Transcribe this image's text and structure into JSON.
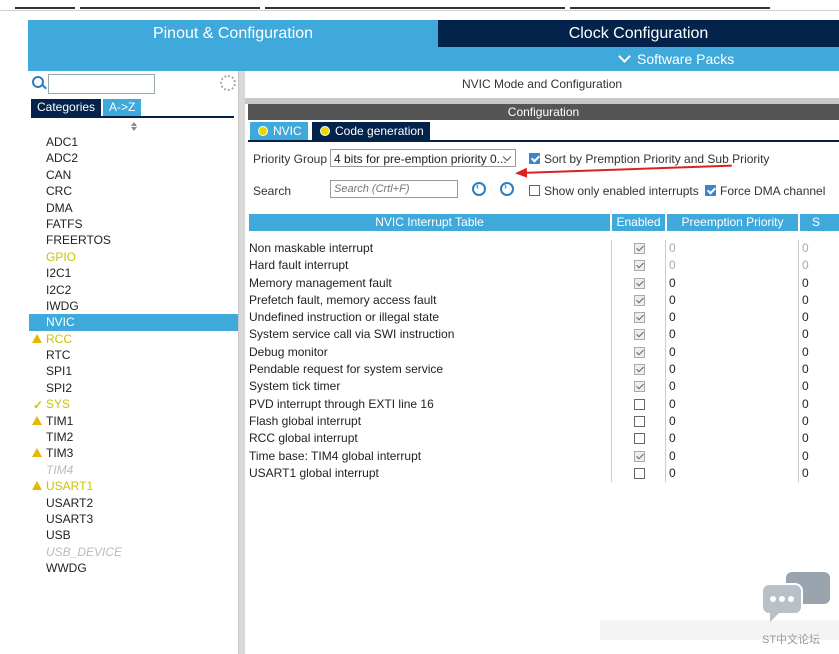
{
  "tabs": {
    "pinout": "Pinout & Configuration",
    "clock": "Clock Configuration",
    "software_packs": "Software Packs"
  },
  "left": {
    "search_value": "",
    "category_tabs": [
      "Categories",
      "A->Z"
    ],
    "items": [
      {
        "label": "ADC1",
        "state": "normal"
      },
      {
        "label": "ADC2",
        "state": "normal"
      },
      {
        "label": "CAN",
        "state": "normal"
      },
      {
        "label": "CRC",
        "state": "normal"
      },
      {
        "label": "DMA",
        "state": "normal"
      },
      {
        "label": "FATFS",
        "state": "normal"
      },
      {
        "label": "FREERTOS",
        "state": "normal"
      },
      {
        "label": "GPIO",
        "state": "yellow"
      },
      {
        "label": "I2C1",
        "state": "normal"
      },
      {
        "label": "I2C2",
        "state": "normal"
      },
      {
        "label": "IWDG",
        "state": "normal"
      },
      {
        "label": "NVIC",
        "state": "selected"
      },
      {
        "label": "RCC",
        "state": "warn"
      },
      {
        "label": "RTC",
        "state": "normal"
      },
      {
        "label": "SPI1",
        "state": "normal"
      },
      {
        "label": "SPI2",
        "state": "normal"
      },
      {
        "label": "SYS",
        "state": "check"
      },
      {
        "label": "TIM1",
        "state": "warn-dark"
      },
      {
        "label": "TIM2",
        "state": "normal"
      },
      {
        "label": "TIM3",
        "state": "warn-dark"
      },
      {
        "label": "TIM4",
        "state": "dim"
      },
      {
        "label": "USART1",
        "state": "warn"
      },
      {
        "label": "USART2",
        "state": "normal"
      },
      {
        "label": "USART3",
        "state": "normal"
      },
      {
        "label": "USB",
        "state": "normal"
      },
      {
        "label": "USB_DEVICE",
        "state": "dim"
      },
      {
        "label": "WWDG",
        "state": "normal"
      }
    ]
  },
  "main": {
    "mode_title": "NVIC Mode and Configuration",
    "config_label": "Configuration",
    "subtabs": [
      "NVIC",
      "Code generation"
    ],
    "priority_group_label": "Priority Group",
    "priority_group_value": "4 bits for pre-emption priority 0...",
    "sort_label": "Sort by Premption Priority and Sub Priority",
    "search_label": "Search",
    "search_placeholder": "Search (Crtl+F)",
    "show_enabled_label": "Show only enabled interrupts",
    "force_dma_label": "Force DMA channel",
    "table": {
      "headers": [
        "NVIC Interrupt Table",
        "Enabled",
        "Preemption Priority",
        "S"
      ],
      "rows": [
        {
          "name": "Non maskable interrupt",
          "enabled": true,
          "locked": true,
          "pre": "0",
          "sub": "0"
        },
        {
          "name": "Hard fault interrupt",
          "enabled": true,
          "locked": true,
          "pre": "0",
          "sub": "0"
        },
        {
          "name": "Memory management fault",
          "enabled": true,
          "locked": true,
          "pre": "0",
          "sub": "0"
        },
        {
          "name": "Prefetch fault, memory access fault",
          "enabled": true,
          "locked": true,
          "pre": "0",
          "sub": "0"
        },
        {
          "name": "Undefined instruction or illegal state",
          "enabled": true,
          "locked": true,
          "pre": "0",
          "sub": "0"
        },
        {
          "name": "System service call via SWI instruction",
          "enabled": true,
          "locked": true,
          "pre": "0",
          "sub": "0"
        },
        {
          "name": "Debug monitor",
          "enabled": true,
          "locked": true,
          "pre": "0",
          "sub": "0"
        },
        {
          "name": "Pendable request for system service",
          "enabled": true,
          "locked": true,
          "pre": "0",
          "sub": "0"
        },
        {
          "name": "System tick timer",
          "enabled": true,
          "locked": true,
          "pre": "0",
          "sub": "0"
        },
        {
          "name": "PVD interrupt through EXTI line 16",
          "enabled": false,
          "locked": false,
          "pre": "0",
          "sub": "0"
        },
        {
          "name": "Flash global interrupt",
          "enabled": false,
          "locked": false,
          "pre": "0",
          "sub": "0"
        },
        {
          "name": "RCC global interrupt",
          "enabled": false,
          "locked": false,
          "pre": "0",
          "sub": "0"
        },
        {
          "name": "Time base: TIM4 global interrupt",
          "enabled": true,
          "locked": true,
          "pre": "0",
          "sub": "0"
        },
        {
          "name": "USART1 global interrupt",
          "enabled": false,
          "locked": false,
          "pre": "0",
          "sub": "0"
        }
      ]
    }
  },
  "watermark": "ST中文论坛",
  "colors": {
    "accent": "#3fa9dc",
    "dark": "#03234b",
    "warn": "#e6b800",
    "arrow": "#e02020"
  }
}
